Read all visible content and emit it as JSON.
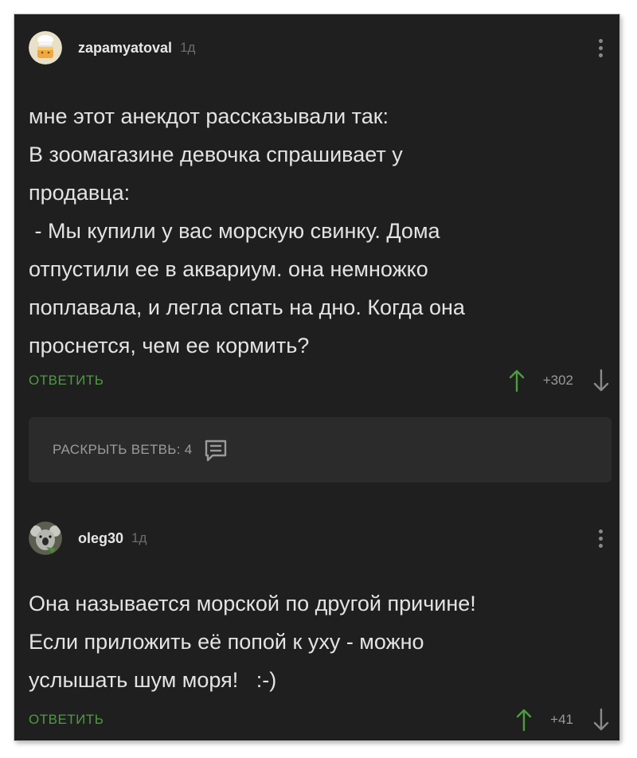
{
  "comments": [
    {
      "username": "zapamyatoval",
      "time": "1д",
      "text": "мне этот анекдот рассказывали так:\nВ зоомагазине девочка спрашивает у\nпродавца:\n - Мы купили у вас морскую свинку. Дома\nотпустили ее в аквариум. она немножко\nпоплавала, и легла спать на дно. Когда она\nпроснется, чем ее кормить?",
      "reply_label": "ОТВЕТИТЬ",
      "rating": "+302",
      "avatar_icon": "chef-cake-avatar"
    },
    {
      "username": "oleg30",
      "time": "1д",
      "text": "Она называется морской по другой причине!\nЕсли приложить её попой к уху - можно\nуслышать шум моря!   :-)",
      "reply_label": "ОТВЕТИТЬ",
      "rating": "+41",
      "avatar_icon": "koala-avatar"
    }
  ],
  "branch": {
    "label": "РАСКРЫТЬ ВЕТВЬ: 4",
    "icon": "comments-icon"
  },
  "colors": {
    "background": "#1f1f1f",
    "accent_green": "#4c9c3e",
    "text": "#e3e3e3",
    "muted": "#9a9a9a"
  }
}
